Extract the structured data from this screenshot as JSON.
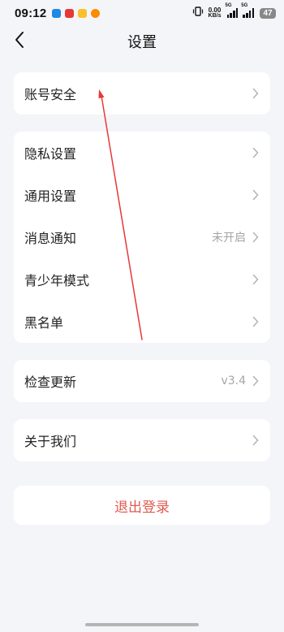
{
  "status_bar": {
    "time": "09:12",
    "net_speed_value": "0.00",
    "net_speed_unit": "KB/s",
    "signal1_label": "5G",
    "signal2_label": "5G",
    "battery": "47",
    "notification_icons": [
      "blue-app-icon",
      "red-app-icon",
      "yellow-app-icon",
      "game-app-icon"
    ]
  },
  "nav": {
    "title": "设置",
    "back_icon": "back-arrow-icon"
  },
  "groups": {
    "account": {
      "label": "账号安全"
    },
    "settings": [
      {
        "label": "隐私设置",
        "value": ""
      },
      {
        "label": "通用设置",
        "value": ""
      },
      {
        "label": "消息通知",
        "value": "未开启"
      },
      {
        "label": "青少年模式",
        "value": ""
      },
      {
        "label": "黑名单",
        "value": ""
      }
    ],
    "update": {
      "label": "检查更新",
      "value": "v3.4"
    },
    "about": {
      "label": "关于我们"
    }
  },
  "logout": {
    "label": "退出登录"
  },
  "colors": {
    "background": "#f4f5f8",
    "card": "#ffffff",
    "logout_text": "#e05a50",
    "secondary_text": "#a6a6a6",
    "annotation_arrow": "#e53935"
  }
}
